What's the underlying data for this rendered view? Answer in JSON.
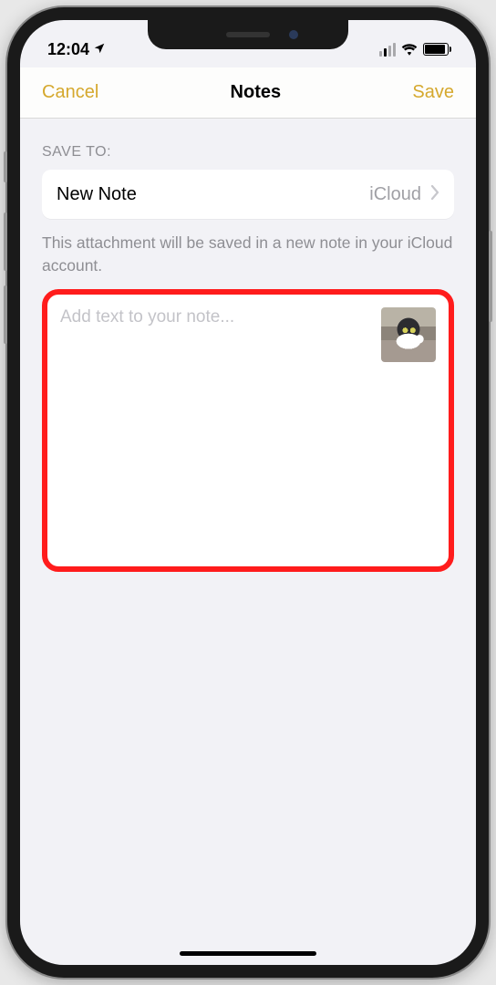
{
  "status": {
    "time": "12:04",
    "location_icon": "◤"
  },
  "nav": {
    "cancel": "Cancel",
    "title": "Notes",
    "save": "Save"
  },
  "section_label": "SAVE TO:",
  "destination": {
    "name": "New Note",
    "account": "iCloud"
  },
  "help_text": "This attachment will be saved in a new note in your iCloud account.",
  "note": {
    "placeholder": "Add text to your note..."
  }
}
